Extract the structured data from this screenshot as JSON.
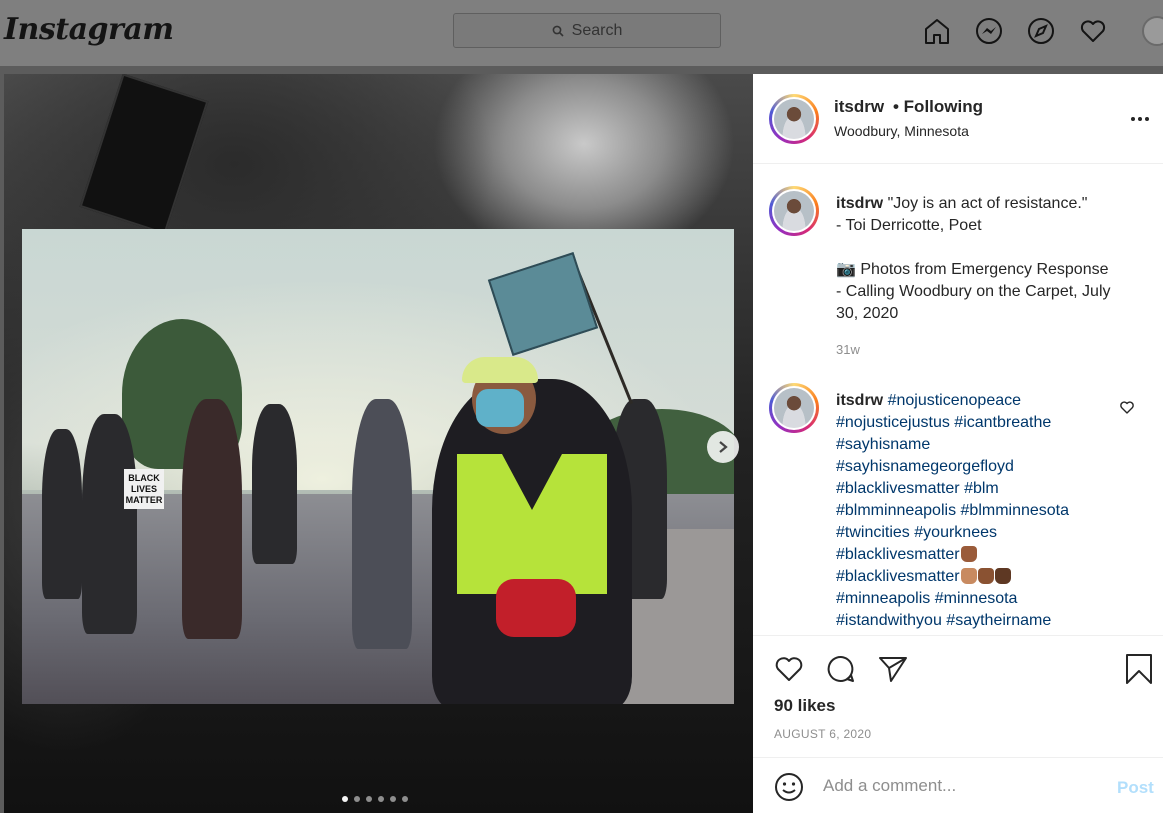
{
  "app": {
    "logo": "Instagram",
    "search_placeholder": "Search",
    "nav_icons": [
      "home-icon",
      "messenger-icon",
      "explore-icon",
      "activity-heart-icon",
      "profile-avatar"
    ]
  },
  "post": {
    "username": "itsdrw",
    "follow_status": "• Following",
    "location": "Woodbury, Minnesota",
    "caption_lines": [
      "\"Joy is an act of resistance.\"",
      "- Toi Derricotte, Poet",
      "",
      "📷 Photos from Emergency Response",
      "- Calling Woodbury on the Carpet, July",
      "30, 2020"
    ],
    "caption_time": "31w",
    "comment": {
      "username": "itsdrw",
      "tag_lines": [
        [
          "#nojusticenopeace"
        ],
        [
          "#nojusticejustus",
          "#icantbreathe"
        ],
        [
          "#sayhisname"
        ],
        [
          "#sayhisnamegeorgefloyd"
        ],
        [
          "#blacklivesmatter",
          "#blm"
        ],
        [
          "#blmminneapolis",
          "#blmminnesota"
        ],
        [
          "#twincities",
          "#yourknees"
        ],
        [
          "#blacklivesmatter"
        ],
        [
          "#blacklivesmatter"
        ],
        [
          "#minneapolis",
          "#minnesota"
        ],
        [
          "#istandwithyou",
          "#saytheirname"
        ]
      ]
    },
    "likes": "90 likes",
    "date": "AUGUST 6, 2020",
    "comment_placeholder": "Add a comment...",
    "post_button": "Post",
    "carousel": {
      "total": 6,
      "current": 1
    },
    "photo": {
      "sign_text": "BLACK LIVES MATTER"
    }
  },
  "colors": {
    "hashtag": "#00376b",
    "post_button": "#b2dffc",
    "overlay": "#5c5c5c"
  }
}
